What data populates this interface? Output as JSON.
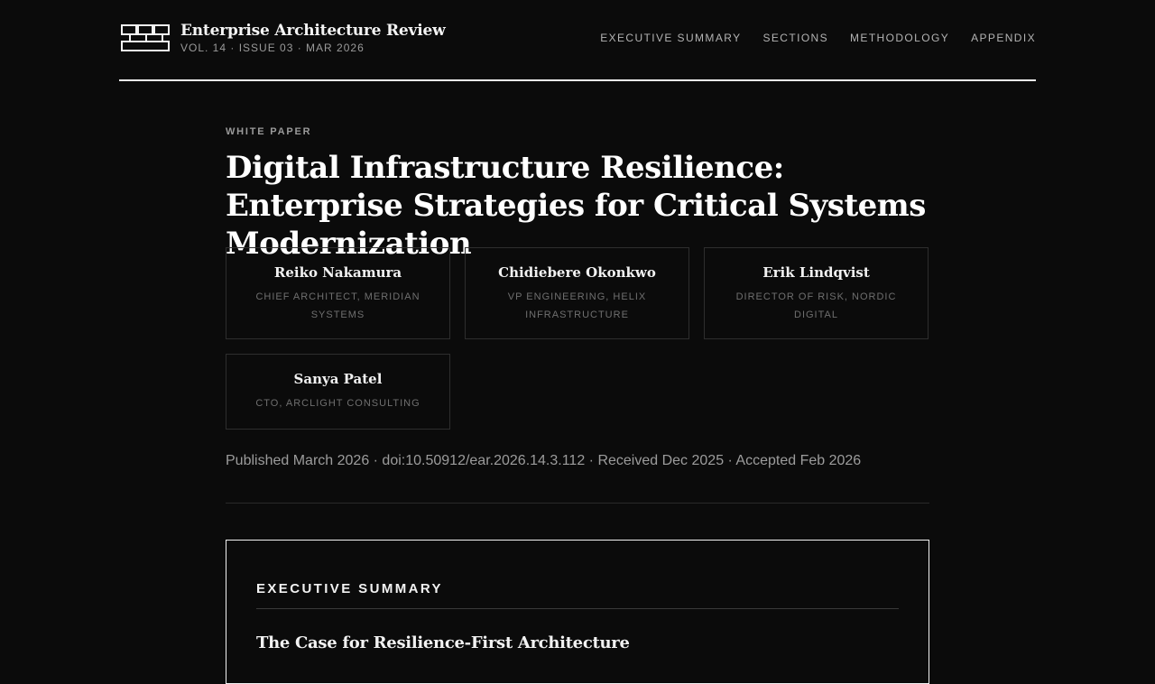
{
  "brand": {
    "title": "Enterprise Architecture Review",
    "meta": "VOL. 14 · ISSUE 03 · MAR 2026",
    "logo_icon": "brick-wall-icon"
  },
  "nav": {
    "items": [
      {
        "label": "EXECUTIVE SUMMARY"
      },
      {
        "label": "SECTIONS"
      },
      {
        "label": "METHODOLOGY"
      },
      {
        "label": "APPENDIX"
      }
    ]
  },
  "article": {
    "eyebrow": "WHITE PAPER",
    "title": "Digital Infrastructure Resilience: Enterprise Strategies for Critical Systems Modernization",
    "authors": [
      {
        "name": "Reiko Nakamura",
        "role": "Chief Architect, Meridian Systems"
      },
      {
        "name": "Chidiebere Okonkwo",
        "role": "VP Engineering, Helix Infrastructure"
      },
      {
        "name": "Erik Lindqvist",
        "role": "Director of Risk, Nordic Digital"
      },
      {
        "name": "Sanya Patel",
        "role": "CTO, Arclight Consulting"
      }
    ],
    "publication_meta": "Published March 2026 · doi:10.50912/ear.2026.14.3.112 · Received Dec 2025 · Accepted Feb 2026"
  },
  "summary": {
    "label": "EXECUTIVE SUMMARY",
    "heading": "The Case for Resilience-First Architecture"
  },
  "colors": {
    "background": "#0b0b0b",
    "text": "#f2f2f2",
    "muted": "#9a9a9a",
    "border": "#2e2e2e"
  }
}
